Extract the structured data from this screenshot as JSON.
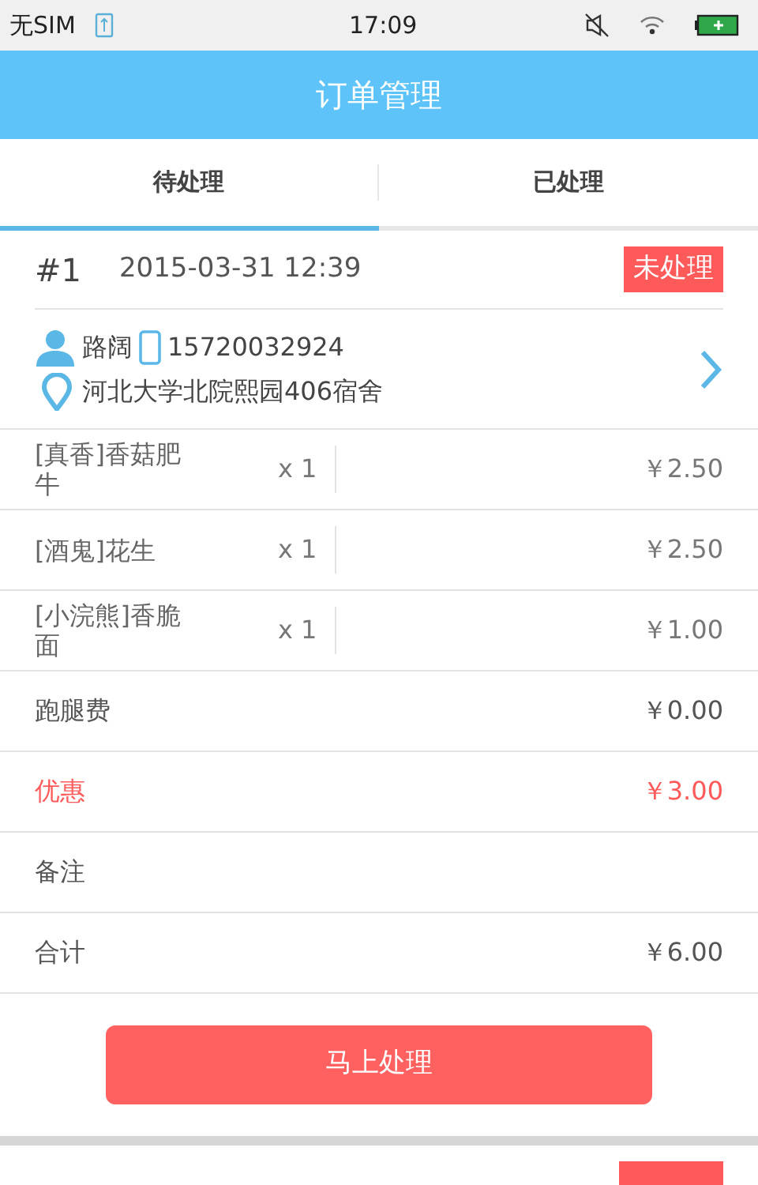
{
  "status_bar": {
    "carrier": "无SIM",
    "time": "17:09"
  },
  "header": {
    "title": "订单管理"
  },
  "tabs": [
    {
      "label": "待处理",
      "selected": true
    },
    {
      "label": "已处理",
      "selected": false
    }
  ],
  "order": {
    "number": "#1",
    "time": "2015-03-31 12:39",
    "status": "未处理",
    "name": "路阔",
    "phone": "15720032924",
    "address": "河北大学北院熙园406宿舍",
    "rows": [
      {
        "kind": "item",
        "name": "[真香]香菇肥牛",
        "qty": "x 1",
        "price": "￥2.50"
      },
      {
        "kind": "item",
        "name": "[酒鬼]花生",
        "qty": "x 1",
        "price": "￥2.50"
      },
      {
        "kind": "item",
        "name": "[小浣熊]香脆面",
        "qty": "x 1",
        "price": "￥1.00"
      },
      {
        "kind": "summary",
        "label": "跑腿费",
        "value": "￥0.00",
        "color": "#555555"
      },
      {
        "kind": "summary",
        "label": "优惠",
        "value": "￥3.00",
        "color": "#ff5a5a"
      },
      {
        "kind": "summary",
        "label": "备注",
        "color": "#555555"
      },
      {
        "kind": "summary",
        "label": "合计",
        "value": "￥6.00",
        "color": "#555555"
      }
    ],
    "action": "马上处理"
  }
}
